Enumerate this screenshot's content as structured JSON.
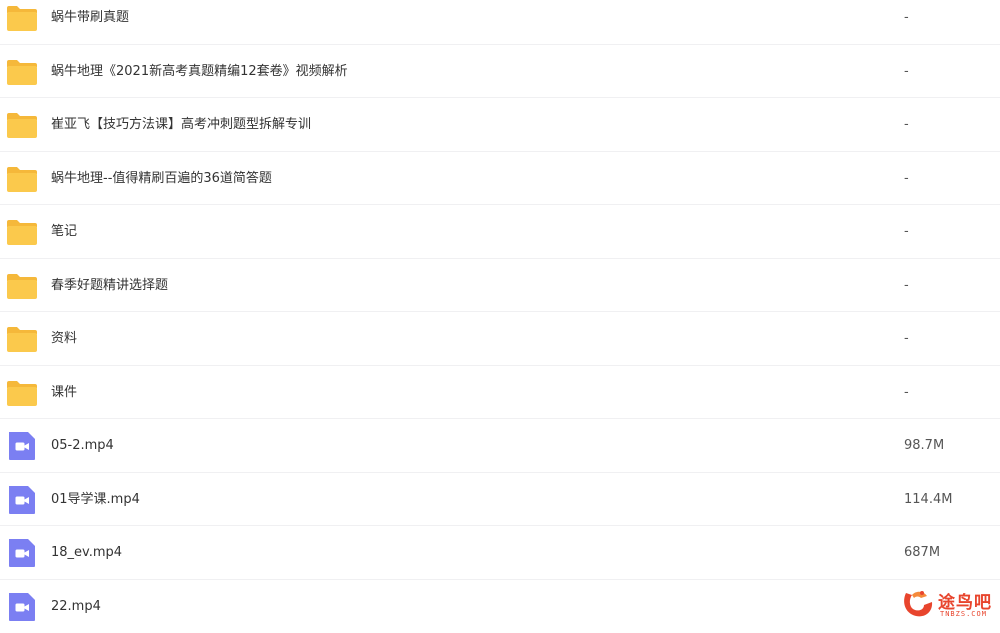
{
  "files": [
    {
      "type": "folder",
      "icon": "folder-icon",
      "name": "蜗牛带刷真题",
      "size": "-"
    },
    {
      "type": "folder",
      "icon": "folder-icon",
      "name": "蜗牛地理《2021新高考真题精编12套卷》视频解析",
      "size": "-"
    },
    {
      "type": "folder",
      "icon": "folder-icon",
      "name": "崔亚飞【技巧方法课】高考冲刺题型拆解专训",
      "size": "-"
    },
    {
      "type": "folder",
      "icon": "folder-icon",
      "name": "蜗牛地理--值得精刷百遍的36道简答题",
      "size": "-"
    },
    {
      "type": "folder",
      "icon": "folder-icon",
      "name": "笔记",
      "size": "-"
    },
    {
      "type": "folder",
      "icon": "folder-icon",
      "name": "春季好题精讲选择题",
      "size": "-"
    },
    {
      "type": "folder",
      "icon": "folder-icon",
      "name": "资料",
      "size": "-"
    },
    {
      "type": "folder",
      "icon": "folder-icon",
      "name": "课件",
      "size": "-"
    },
    {
      "type": "video",
      "icon": "video-file-icon",
      "name": "05-2.mp4",
      "size": "98.7M"
    },
    {
      "type": "video",
      "icon": "video-file-icon",
      "name": "01导学课.mp4",
      "size": "114.4M"
    },
    {
      "type": "video",
      "icon": "video-file-icon",
      "name": "18_ev.mp4",
      "size": "687M"
    },
    {
      "type": "video",
      "icon": "video-file-icon",
      "name": "22.mp4",
      "size": ""
    }
  ],
  "watermark": {
    "text": "途鸟吧",
    "sub": "TNBZS.COM"
  },
  "colors": {
    "folder": "#fbc94c",
    "folder_back": "#f5b83a",
    "video": "#7b7ff2",
    "watermark": "#e8452d",
    "row_border": "#f0f0f2"
  }
}
